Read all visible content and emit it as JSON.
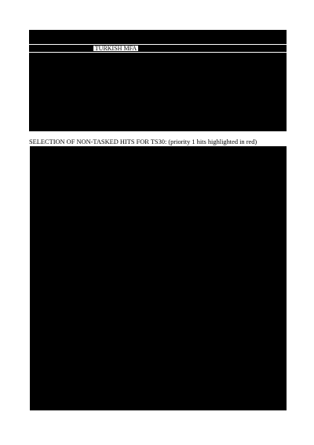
{
  "document": {
    "header_label": "TURKISH MFA",
    "section_heading": "SELECTION OF NON-TASKED HITS FOR TS30: (priority 1 hits highlighted in red)"
  },
  "colors": {
    "redaction": "#000000",
    "background": "#ffffff"
  }
}
